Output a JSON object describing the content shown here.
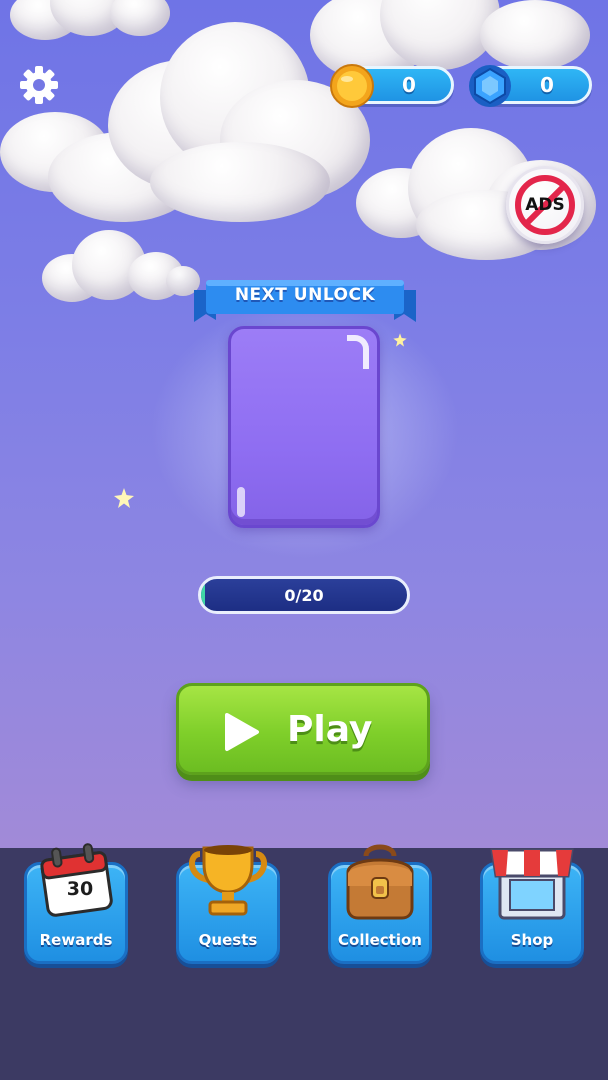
{
  "currency": {
    "coins": "0",
    "gems": "0"
  },
  "badges": {
    "no_ads": "ADS",
    "calendar_day": "30"
  },
  "next_unlock": {
    "label": "NEXT UNLOCK",
    "progress_text": "0/20",
    "progress_fraction": 0.02
  },
  "play": {
    "label": "Play"
  },
  "nav": [
    {
      "label": "Rewards",
      "icon": "calendar-icon"
    },
    {
      "label": "Quests",
      "icon": "trophy-icon"
    },
    {
      "label": "Collection",
      "icon": "backpack-icon"
    },
    {
      "label": "Shop",
      "icon": "shop-icon"
    }
  ],
  "colors": {
    "sky_top": "#6f74e6",
    "sky_bottom": "#a58bd6",
    "accent_blue": "#1f8fe2",
    "play_green": "#7fcf2a",
    "card_purple": "#9c7df6",
    "bottom_bar": "#3c3a63"
  }
}
